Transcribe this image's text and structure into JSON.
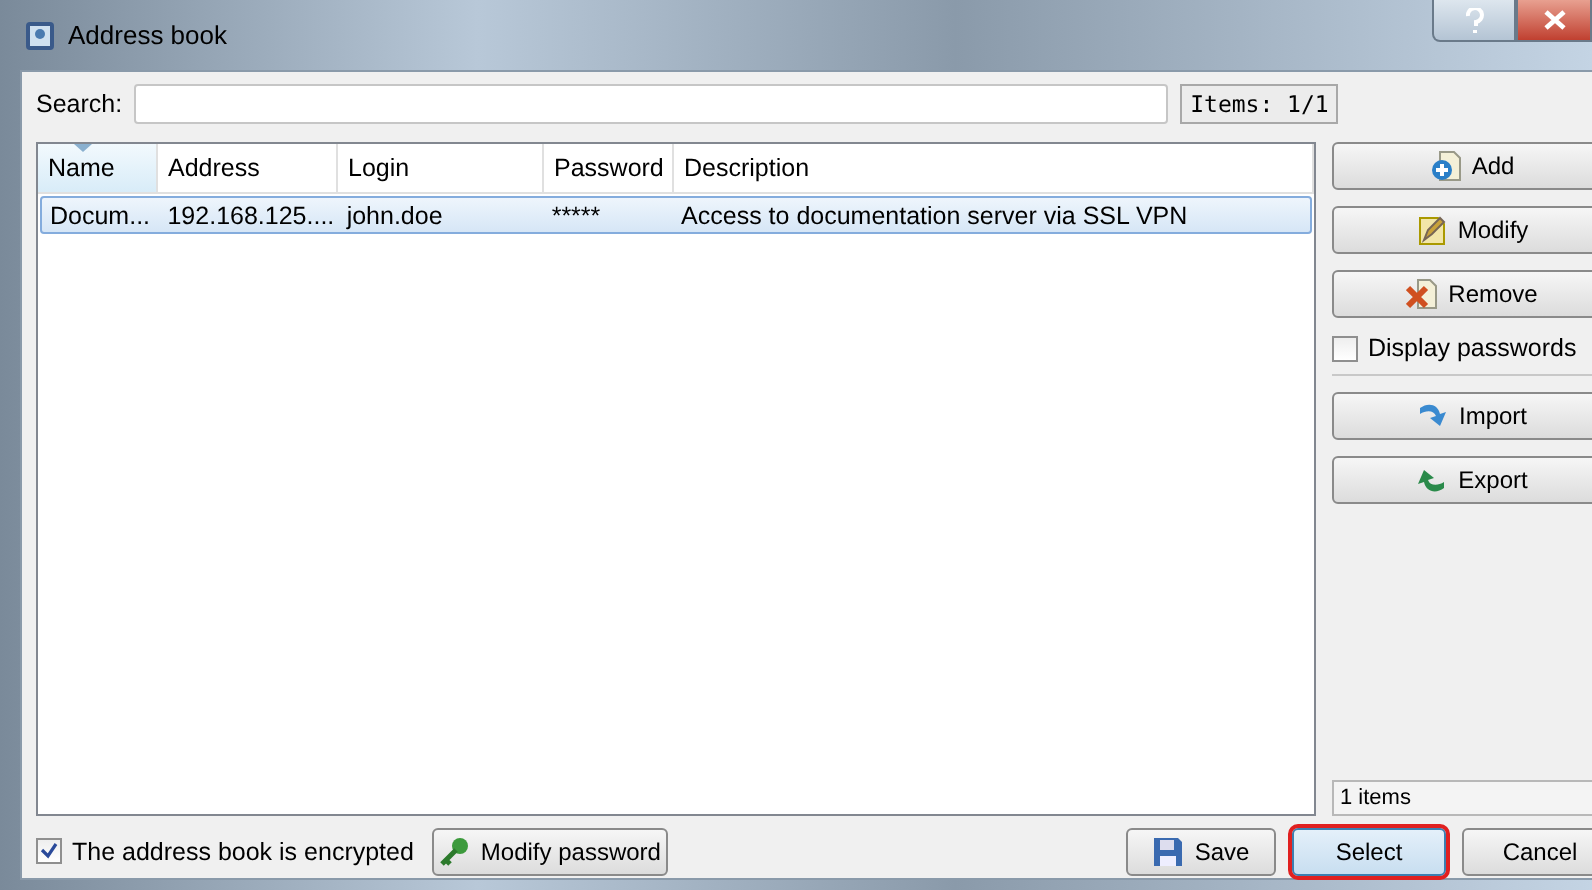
{
  "window": {
    "title": "Address book"
  },
  "search": {
    "label": "Search:",
    "count": "Items: 1/1"
  },
  "table": {
    "columns": [
      {
        "label": "Name",
        "sorted": true
      },
      {
        "label": "Address",
        "sorted": false
      },
      {
        "label": "Login",
        "sorted": false
      },
      {
        "label": "Password",
        "sorted": false
      },
      {
        "label": "Description",
        "sorted": false
      }
    ],
    "rows": [
      {
        "cells": [
          "Docum...",
          "192.168.125....",
          "john.doe",
          "*****",
          "Access to documentation server via SSL VPN"
        ],
        "selected": true
      }
    ]
  },
  "side_buttons": [
    {
      "label": "Add",
      "kind": "add"
    },
    {
      "label": "Modify",
      "kind": "modify"
    },
    {
      "label": "Remove",
      "kind": "remove"
    }
  ],
  "display_passwords": {
    "label": "Display passwords",
    "checked": false
  },
  "transfer_buttons": [
    {
      "label": "Import",
      "kind": "import"
    },
    {
      "label": "Export",
      "kind": "export"
    }
  ],
  "status": "1 items",
  "encrypted": {
    "label": "The address book is encrypted",
    "checked": true
  },
  "modify_password": {
    "label": "Modify password"
  },
  "buttons": [
    {
      "label": "Save",
      "kind": "save",
      "highlighted": false
    },
    {
      "label": "Select",
      "kind": "plain",
      "highlighted": true
    },
    {
      "label": "Cancel",
      "kind": "plain",
      "highlighted": false
    }
  ]
}
